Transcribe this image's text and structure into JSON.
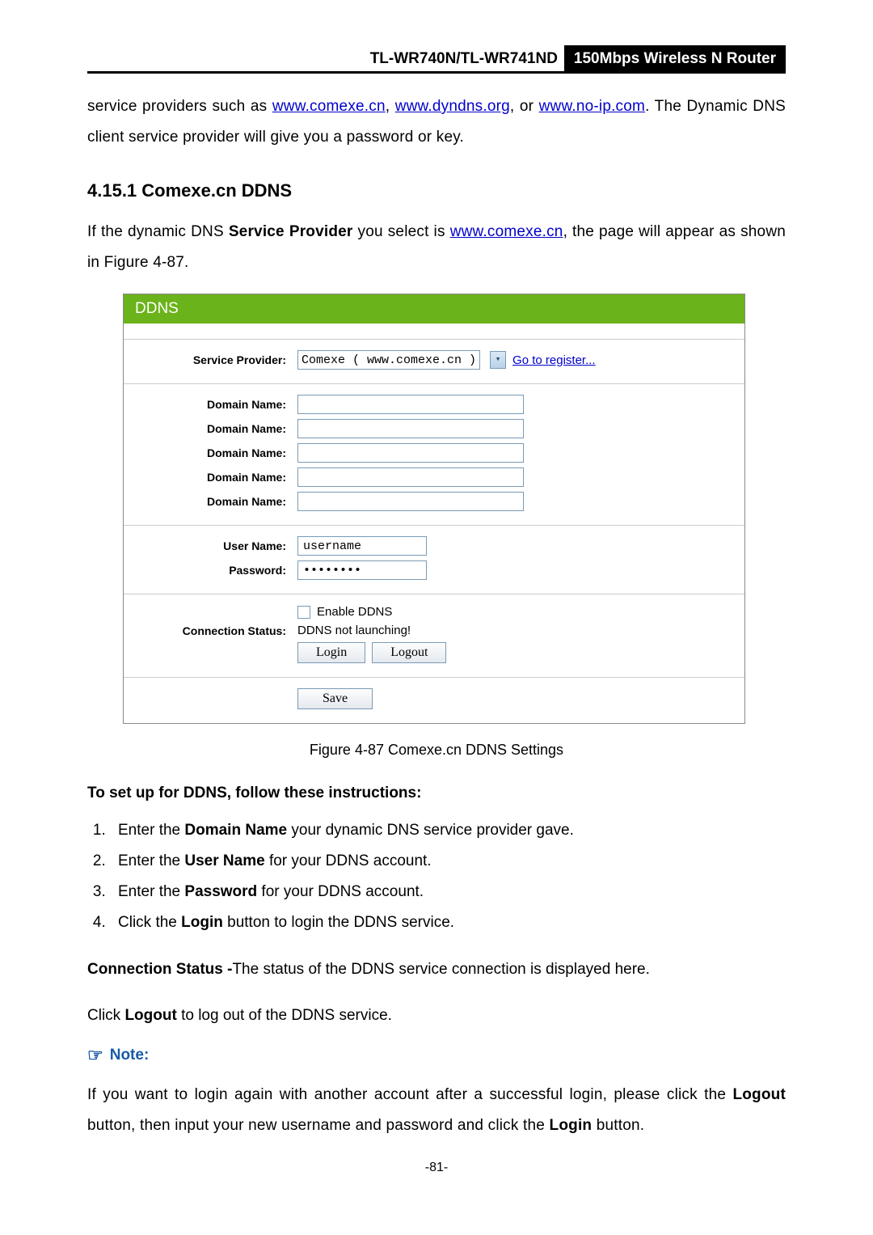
{
  "header": {
    "model": "TL-WR740N/TL-WR741ND",
    "product": "150Mbps Wireless N Router"
  },
  "intro": {
    "pre": "service providers such as ",
    "link1": "www.comexe.cn",
    "sep1": ", ",
    "link2": "www.dyndns.org",
    "sep2": ", or ",
    "link3": "www.no-ip.com",
    "post": ". The Dynamic DNS client service provider will give you a password or key."
  },
  "section": {
    "num_title": "4.15.1  Comexe.cn DDNS",
    "p_pre": "If the dynamic DNS ",
    "p_bold": "Service Provider",
    "p_mid": " you select is ",
    "p_link": "www.comexe.cn",
    "p_post": ", the page will appear as shown in Figure 4-87."
  },
  "panel": {
    "title": "DDNS",
    "labels": {
      "service_provider": "Service Provider:",
      "domain_name": "Domain Name:",
      "user_name": "User Name:",
      "password": "Password:",
      "connection_status": "Connection Status:"
    },
    "service_provider_value": "Comexe ( www.comexe.cn )",
    "register_link": "Go to register...",
    "username_value": "username",
    "password_value": "••••••••",
    "enable_label": "Enable DDNS",
    "status_value": "DDNS not launching!",
    "buttons": {
      "login": "Login",
      "logout": "Logout",
      "save": "Save"
    }
  },
  "caption": "Figure 4-87 Comexe.cn DDNS Settings",
  "instructions": {
    "heading": "To set up for DDNS, follow these instructions:",
    "s1_a": "Enter the ",
    "s1_b": "Domain Name",
    "s1_c": " your dynamic DNS service provider gave.",
    "s2_a": "Enter the ",
    "s2_b": "User Name",
    "s2_c": " for your DDNS account.",
    "s3_a": "Enter the ",
    "s3_b": "Password",
    "s3_c": " for your DDNS account.",
    "s4_a": "Click the ",
    "s4_b": "Login",
    "s4_c": " button to login the DDNS service."
  },
  "conn_line": {
    "b": "Connection Status -",
    "rest": "The status of the DDNS service connection is displayed here."
  },
  "logout_line": {
    "a": "Click ",
    "b": "Logout",
    "c": " to log out of the DDNS service."
  },
  "note": {
    "label": "Note:",
    "p_a": " If you want to login again with another account after a successful login, please click the ",
    "p_b": "Logout",
    "p_c": " button, then input your new username and password and click the ",
    "p_d": "Login",
    "p_e": " button."
  },
  "page_number": "-81-"
}
